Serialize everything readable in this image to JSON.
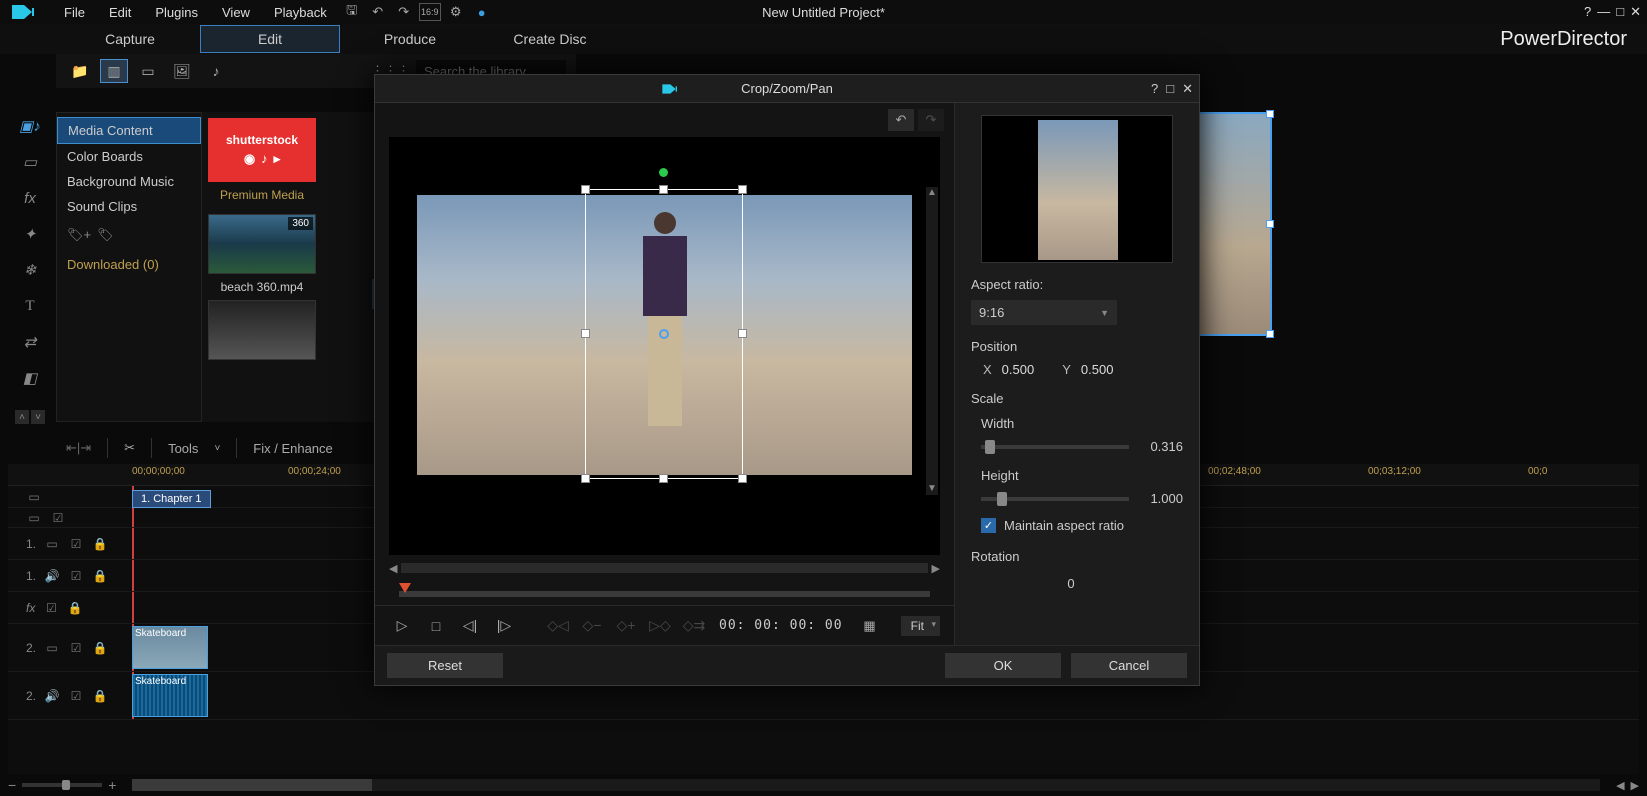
{
  "app": {
    "name": "PowerDirector",
    "project_title": "New Untitled Project*"
  },
  "menu": {
    "file": "File",
    "edit": "Edit",
    "plugins": "Plugins",
    "view": "View",
    "playback": "Playback",
    "aspect_badge": "16:9"
  },
  "tabs": {
    "capture": "Capture",
    "edit": "Edit",
    "produce": "Produce",
    "create_disc": "Create Disc"
  },
  "library": {
    "search_placeholder": "Search the library",
    "cats": {
      "media": "Media Content",
      "color": "Color Boards",
      "bgm": "Background Music",
      "sound": "Sound Clips"
    },
    "downloaded": "Downloaded  (0)",
    "stock_label": "shutterstock",
    "premium": "Premium Media",
    "thumb_badge": "360",
    "thumb_name": "beach 360.mp4"
  },
  "timeline_tools": {
    "tools": "Tools",
    "fix": "Fix / Enhance"
  },
  "timeline": {
    "ticks": [
      "00;00;00;00",
      "00;00;24;00",
      "00;02;48;00",
      "00;03;12;00",
      "00;0"
    ],
    "chapter": "1. Chapter 1",
    "track_labels": {
      "v1": "1.",
      "a1": "1.",
      "fx": "fx",
      "v2": "2.",
      "a2": "2."
    },
    "clip_name": "Skateboard"
  },
  "dialog": {
    "title": "Crop/Zoom/Pan",
    "aspect_label": "Aspect ratio:",
    "aspect_value": "9:16",
    "position_label": "Position",
    "pos_x_label": "X",
    "pos_x": "0.500",
    "pos_y_label": "Y",
    "pos_y": "0.500",
    "scale_label": "Scale",
    "width_label": "Width",
    "width_val": "0.316",
    "height_label": "Height",
    "height_val": "1.000",
    "maintain": "Maintain aspect ratio",
    "rotation_label": "Rotation",
    "rotation_val": "0",
    "timecode": "00: 00: 00: 00",
    "fit": "Fit",
    "reset": "Reset",
    "ok": "OK",
    "cancel": "Cancel"
  }
}
